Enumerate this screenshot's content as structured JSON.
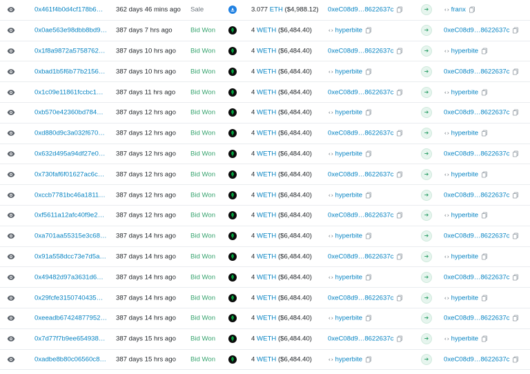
{
  "rows": [
    {
      "hash": "0x461f4b0d4cf178b6…",
      "age": "362 days 46 mins ago",
      "method": "Sale",
      "method_color": "gray",
      "market": "opensea",
      "price_amount": "3.077",
      "price_token": "ETH",
      "price_usd": "($4,988.12)",
      "from": {
        "label": "0xeC08d9…8622637c",
        "kind": "address"
      },
      "to": {
        "label": "franx",
        "kind": "name"
      }
    },
    {
      "hash": "0x0ae563e98dbb8bd9…",
      "age": "387 days 7 hrs ago",
      "method": "Bid Won",
      "method_color": "green",
      "market": "blur",
      "price_amount": "4",
      "price_token": "WETH",
      "price_usd": "($6,484.40)",
      "from": {
        "label": "hyperbite",
        "kind": "name"
      },
      "to": {
        "label": "0xeC08d9…8622637c",
        "kind": "address"
      }
    },
    {
      "hash": "0x1f8a9872a5758762…",
      "age": "387 days 10 hrs ago",
      "method": "Bid Won",
      "method_color": "green",
      "market": "blur",
      "price_amount": "4",
      "price_token": "WETH",
      "price_usd": "($6,484.40)",
      "from": {
        "label": "0xeC08d9…8622637c",
        "kind": "address"
      },
      "to": {
        "label": "hyperbite",
        "kind": "name"
      }
    },
    {
      "hash": "0xbad1b5f6b77b2156…",
      "age": "387 days 10 hrs ago",
      "method": "Bid Won",
      "method_color": "green",
      "market": "blur",
      "price_amount": "4",
      "price_token": "WETH",
      "price_usd": "($6,484.40)",
      "from": {
        "label": "hyperbite",
        "kind": "name"
      },
      "to": {
        "label": "0xeC08d9…8622637c",
        "kind": "address"
      }
    },
    {
      "hash": "0x1c09e11861fccbc1…",
      "age": "387 days 11 hrs ago",
      "method": "Bid Won",
      "method_color": "green",
      "market": "blur",
      "price_amount": "4",
      "price_token": "WETH",
      "price_usd": "($6,484.40)",
      "from": {
        "label": "0xeC08d9…8622637c",
        "kind": "address"
      },
      "to": {
        "label": "hyperbite",
        "kind": "name"
      }
    },
    {
      "hash": "0xb570e42360bd784…",
      "age": "387 days 12 hrs ago",
      "method": "Bid Won",
      "method_color": "green",
      "market": "blur",
      "price_amount": "4",
      "price_token": "WETH",
      "price_usd": "($6,484.40)",
      "from": {
        "label": "hyperbite",
        "kind": "name"
      },
      "to": {
        "label": "0xeC08d9…8622637c",
        "kind": "address"
      }
    },
    {
      "hash": "0xd880d9c3a032f670…",
      "age": "387 days 12 hrs ago",
      "method": "Bid Won",
      "method_color": "green",
      "market": "blur",
      "price_amount": "4",
      "price_token": "WETH",
      "price_usd": "($6,484.40)",
      "from": {
        "label": "0xeC08d9…8622637c",
        "kind": "address"
      },
      "to": {
        "label": "hyperbite",
        "kind": "name"
      }
    },
    {
      "hash": "0x632d495a94df27e0…",
      "age": "387 days 12 hrs ago",
      "method": "Bid Won",
      "method_color": "green",
      "market": "blur",
      "price_amount": "4",
      "price_token": "WETH",
      "price_usd": "($6,484.40)",
      "from": {
        "label": "hyperbite",
        "kind": "name"
      },
      "to": {
        "label": "0xeC08d9…8622637c",
        "kind": "address"
      }
    },
    {
      "hash": "0x730faf6f01627ac6c…",
      "age": "387 days 12 hrs ago",
      "method": "Bid Won",
      "method_color": "green",
      "market": "blur",
      "price_amount": "4",
      "price_token": "WETH",
      "price_usd": "($6,484.40)",
      "from": {
        "label": "0xeC08d9…8622637c",
        "kind": "address"
      },
      "to": {
        "label": "hyperbite",
        "kind": "name"
      }
    },
    {
      "hash": "0xccb7781bc46a1811…",
      "age": "387 days 12 hrs ago",
      "method": "Bid Won",
      "method_color": "green",
      "market": "blur",
      "price_amount": "4",
      "price_token": "WETH",
      "price_usd": "($6,484.40)",
      "from": {
        "label": "hyperbite",
        "kind": "name"
      },
      "to": {
        "label": "0xeC08d9…8622637c",
        "kind": "address"
      }
    },
    {
      "hash": "0xf5611a12afc40f9e2…",
      "age": "387 days 12 hrs ago",
      "method": "Bid Won",
      "method_color": "green",
      "market": "blur",
      "price_amount": "4",
      "price_token": "WETH",
      "price_usd": "($6,484.40)",
      "from": {
        "label": "0xeC08d9…8622637c",
        "kind": "address"
      },
      "to": {
        "label": "hyperbite",
        "kind": "name"
      }
    },
    {
      "hash": "0xa701aa55315e3c68…",
      "age": "387 days 14 hrs ago",
      "method": "Bid Won",
      "method_color": "green",
      "market": "blur",
      "price_amount": "4",
      "price_token": "WETH",
      "price_usd": "($6,484.40)",
      "from": {
        "label": "hyperbite",
        "kind": "name"
      },
      "to": {
        "label": "0xeC08d9…8622637c",
        "kind": "address"
      }
    },
    {
      "hash": "0x91a558dcc73e7d5a…",
      "age": "387 days 14 hrs ago",
      "method": "Bid Won",
      "method_color": "green",
      "market": "blur",
      "price_amount": "4",
      "price_token": "WETH",
      "price_usd": "($6,484.40)",
      "from": {
        "label": "0xeC08d9…8622637c",
        "kind": "address"
      },
      "to": {
        "label": "hyperbite",
        "kind": "name"
      }
    },
    {
      "hash": "0x49482d97a3631d6…",
      "age": "387 days 14 hrs ago",
      "method": "Bid Won",
      "method_color": "green",
      "market": "blur",
      "price_amount": "4",
      "price_token": "WETH",
      "price_usd": "($6,484.40)",
      "from": {
        "label": "hyperbite",
        "kind": "name"
      },
      "to": {
        "label": "0xeC08d9…8622637c",
        "kind": "address"
      }
    },
    {
      "hash": "0x29fcfe3150740435…",
      "age": "387 days 14 hrs ago",
      "method": "Bid Won",
      "method_color": "green",
      "market": "blur",
      "price_amount": "4",
      "price_token": "WETH",
      "price_usd": "($6,484.40)",
      "from": {
        "label": "0xeC08d9…8622637c",
        "kind": "address"
      },
      "to": {
        "label": "hyperbite",
        "kind": "name"
      }
    },
    {
      "hash": "0xeeadb67424877952…",
      "age": "387 days 14 hrs ago",
      "method": "Bid Won",
      "method_color": "green",
      "market": "blur",
      "price_amount": "4",
      "price_token": "WETH",
      "price_usd": "($6,484.40)",
      "from": {
        "label": "hyperbite",
        "kind": "name"
      },
      "to": {
        "label": "0xeC08d9…8622637c",
        "kind": "address"
      }
    },
    {
      "hash": "0x7d77f7b9ee654938…",
      "age": "387 days 15 hrs ago",
      "method": "Bid Won",
      "method_color": "green",
      "market": "blur",
      "price_amount": "4",
      "price_token": "WETH",
      "price_usd": "($6,484.40)",
      "from": {
        "label": "0xeC08d9…8622637c",
        "kind": "address"
      },
      "to": {
        "label": "hyperbite",
        "kind": "name"
      }
    },
    {
      "hash": "0xadbe8b80c06560c8…",
      "age": "387 days 15 hrs ago",
      "method": "Bid Won",
      "method_color": "green",
      "market": "blur",
      "price_amount": "4",
      "price_token": "WETH",
      "price_usd": "($6,484.40)",
      "from": {
        "label": "hyperbite",
        "kind": "name"
      },
      "to": {
        "label": "0xeC08d9…8622637c",
        "kind": "address"
      }
    }
  ],
  "icons": {
    "view": "eye-icon",
    "market_opensea": "opensea-icon",
    "market_blur": "blur-icon",
    "direction": "arrow-right-icon",
    "copy": "copy-icon",
    "contract": "code-icon"
  },
  "colors": {
    "link": "#0784c3",
    "method_green": "#36a36e",
    "method_gray": "#6c757d",
    "opensea": "#2081e2",
    "blur": "#0b0b0b",
    "blur_mark": "#00ff5f",
    "arrow_bg": "#e6f5ee"
  }
}
